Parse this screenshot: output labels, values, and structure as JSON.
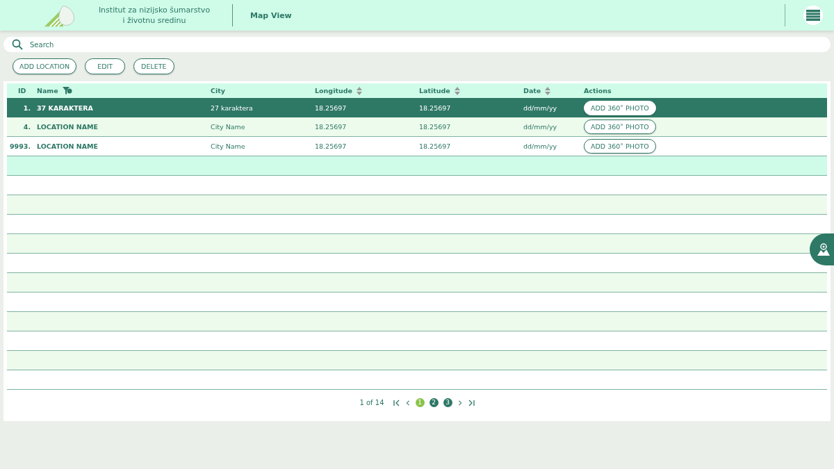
{
  "header": {
    "org_name_line1": "Institut za nizijsko šumarstvo",
    "org_name_line2": "i životnu sredinu",
    "view_link": "Map View"
  },
  "search": {
    "placeholder": "Search"
  },
  "toolbar": {
    "buttons": [
      "ADD LOCATION",
      "EDIT",
      "DELETE"
    ]
  },
  "table": {
    "columns": [
      {
        "label": "ID",
        "kind": "plain"
      },
      {
        "label": "Name",
        "kind": "filter"
      },
      {
        "label": "City",
        "kind": "plain"
      },
      {
        "label": "Longitude",
        "kind": "sort"
      },
      {
        "label": "Latitude",
        "kind": "sort"
      },
      {
        "label": "Date",
        "kind": "sort"
      },
      {
        "label": "Actions",
        "kind": "plain"
      }
    ],
    "rows": [
      {
        "id": "1.",
        "name": "37 KARAKTERA",
        "city": "27 karaktera",
        "longitude": "18.25697",
        "latitude": "18.25697",
        "date": "dd/mm/yy",
        "action": "ADD 360˚ PHOTO",
        "selected": true
      },
      {
        "id": "4.",
        "name": "LOCATION NAME",
        "city": "City Name",
        "longitude": "18.25697",
        "latitude": "18.25697",
        "date": "dd/mm/yy",
        "action": "ADD 360˚ PHOTO",
        "selected": false
      },
      {
        "id": "9993.",
        "name": "LOCATION NAME",
        "city": "City Name",
        "longitude": "18.25697",
        "latitude": "18.25697",
        "date": "dd/mm/yy",
        "action": "ADD 360˚ PHOTO",
        "selected": false
      }
    ]
  },
  "pagination": {
    "summary": "1 of 14",
    "pages": [
      {
        "label": "1",
        "selected": true
      },
      {
        "label": "2",
        "selected": false
      },
      {
        "label": "3",
        "selected": false
      }
    ]
  }
}
